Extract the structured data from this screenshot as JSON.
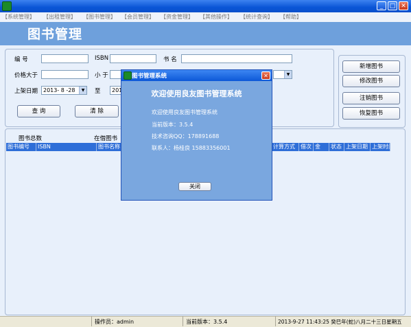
{
  "window": {
    "minimize": "_",
    "maximize": "□",
    "close": "✕"
  },
  "menu": [
    "【系统管理】",
    "【出租管理】",
    "【图书管理】",
    "【会员管理】",
    "【资金管理】",
    "【其他操作】",
    "【统计查询】",
    "【帮助】"
  ],
  "page_title": "图书管理",
  "search": {
    "id_label": "编  号",
    "isbn_label": "ISBN",
    "name_label": "书  名",
    "price_gt_label": "价格大于",
    "price_lt_label": "小  于",
    "date_label": "上架日期",
    "date_from": "2013- 8 -28",
    "date_to_label": "至",
    "date_to": "201",
    "query_button": "查 询",
    "clear_button": "清 除"
  },
  "actions": {
    "add": "新增图书",
    "edit": "修改图书",
    "remove": "注销图书",
    "restore": "恢复图书"
  },
  "stats": {
    "total_label": "图书总数",
    "borrowed_label": "在借图书"
  },
  "grid": {
    "columns": [
      "图书编号",
      "ISBN",
      "图书名称",
      "计算方式",
      "借次",
      "金",
      "状态",
      "上架日期",
      "上架时间"
    ]
  },
  "dialog": {
    "title": "图书管理系统",
    "heading": "欢迎使用良友图书管理系统",
    "welcome": "欢迎使用良友图书管理系统",
    "version": "当前版本：3.5.4",
    "qq": "技术咨询QQ：178891688",
    "contact": "联系人：杨桂良    15883356001",
    "close_button": "关闭"
  },
  "status": {
    "operator": "操作员：admin",
    "version": "当前版本：3.5.4",
    "datetime": "2013-9-27 11:43:25 癸巳年(蛇)八月二十三日星期五"
  }
}
